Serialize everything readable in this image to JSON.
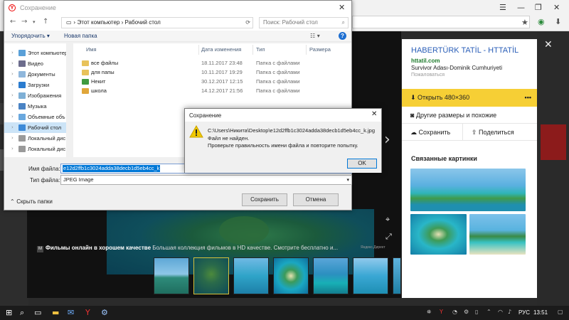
{
  "colors": {
    "accent": "#0078d7",
    "yellow_button": "#f6cf35",
    "link": "#2b5fb8",
    "green_link": "#1d7a2b",
    "warning": "#f0c800"
  },
  "save_dialog": {
    "title": "Сохранение",
    "address": {
      "segments": [
        "Этот компьютер",
        "Рабочий стол"
      ],
      "separator": "›"
    },
    "search_placeholder": "Поиск: Рабочий стол",
    "commands": {
      "organize": "Упорядочить ▾",
      "new_folder": "Новая папка"
    },
    "sidebar": [
      {
        "label": "Этот компьютер",
        "icon": "computer-icon",
        "selected": false
      },
      {
        "label": "Видео",
        "icon": "video-folder-icon",
        "selected": false
      },
      {
        "label": "Документы",
        "icon": "documents-folder-icon",
        "selected": false
      },
      {
        "label": "Загрузки",
        "icon": "downloads-folder-icon",
        "selected": false
      },
      {
        "label": "Изображения",
        "icon": "pictures-folder-icon",
        "selected": false
      },
      {
        "label": "Музыка",
        "icon": "music-folder-icon",
        "selected": false
      },
      {
        "label": "Объемные объ",
        "icon": "3d-objects-icon",
        "selected": false
      },
      {
        "label": "Рабочий стол",
        "icon": "desktop-folder-icon",
        "selected": true
      },
      {
        "label": "Локальный дис",
        "icon": "disk-icon",
        "selected": false
      },
      {
        "label": "Локальный дис",
        "icon": "disk-icon",
        "selected": false
      }
    ],
    "columns": [
      "Имя",
      "Дата изменения",
      "Тип",
      "Размера"
    ],
    "files": [
      {
        "name": "все файлы",
        "date": "18.11.2017 23:48",
        "type": "Папка с файлами",
        "icon": "folder-icon"
      },
      {
        "name": "для папы",
        "date": "10.11.2017 19:29",
        "type": "Папка с файлами",
        "icon": "folder-icon"
      },
      {
        "name": "Некит",
        "date": "30.12.2017 12:15",
        "type": "Папка с файлами",
        "icon": "folder-icon"
      },
      {
        "name": "школа",
        "date": "14.12.2017 21:56",
        "type": "Папка с файлами",
        "icon": "folder-icon"
      }
    ],
    "file_name_label": "Имя файла:",
    "file_name_value": "e12d2ffb1c3024adda38decb1d5eb4cc_k",
    "file_type_label": "Тип файла:",
    "file_type_value": "JPEG Image",
    "hide_folders": "Скрыть папки",
    "save_button": "Сохранить",
    "cancel_button": "Отмена"
  },
  "error_dialog": {
    "title": "Сохранение",
    "path": "C:\\Users\\Никита\\Desktop\\e12d2ffb1c3024adda38decb1d5eb4cc_k.jpg",
    "message1": "Файл не найден.",
    "message2": "Проверьте правильность имени файла и повторите попытку.",
    "ok_button": "OK"
  },
  "viewer": {
    "ad_title": "Фильмы онлайн в хорошем качестве",
    "ad_text": "Большая коллекция фильмов в HD качестве. Смотрите бесплатно и...",
    "ad_tag": "Яндекс.Директ",
    "thumbnail_count": 7,
    "selected_thumbnail": 1
  },
  "panel": {
    "title": "HABERTÜRK TATİL - HTTATİL",
    "site": "httatil.com",
    "description": "Survivor Adası-Dominik Cumhuriyeti",
    "complain": "Пожаловаться",
    "open": "Открыть  480×360",
    "more": "•••",
    "other_sizes": "Другие размеры и похожие",
    "save": "Сохранить",
    "share": "Поделиться",
    "related": "Связанные картинки"
  },
  "taskbar": {
    "language": "РУС",
    "time": "13:51"
  }
}
